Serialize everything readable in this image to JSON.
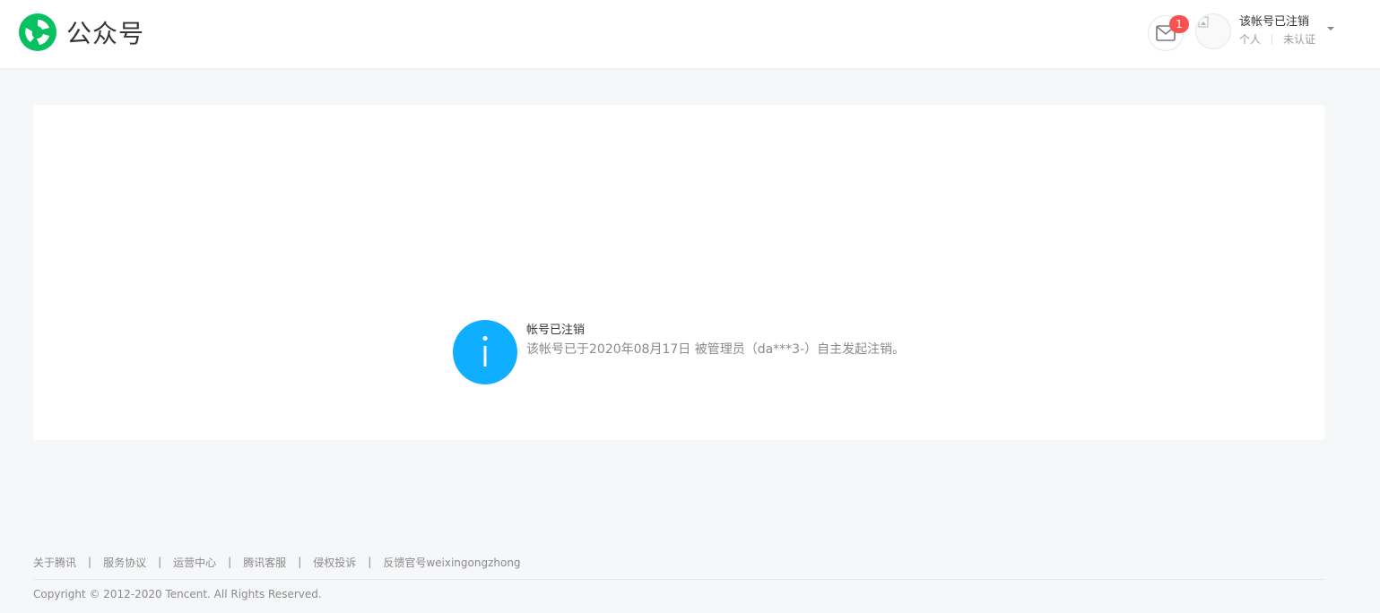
{
  "header": {
    "logo_text": "公众号",
    "message_badge": "1",
    "account_name": "该帐号已注销",
    "account_type": "个人",
    "account_status": "未认证",
    "icons": [
      "wechat-logo-icon",
      "mail-icon",
      "caret-down-icon"
    ]
  },
  "notice": {
    "icon": "info-icon",
    "title": "帐号已注销",
    "description": "该帐号已于2020年08月17日   被管理员（da***3-）自主发起注销。"
  },
  "footer": {
    "links": [
      "关于腾讯",
      "服务协议",
      "运营中心",
      "腾讯客服",
      "侵权投诉",
      "反馈官号weixingongzhong"
    ],
    "separator": "|",
    "copyright": "Copyright © 2012-2020 Tencent. All Rights Reserved."
  },
  "colors": {
    "brand_green": "#07c160",
    "info_blue": "#10aeff",
    "badge_red": "#fa5151",
    "page_bg": "#f6f7f9"
  }
}
